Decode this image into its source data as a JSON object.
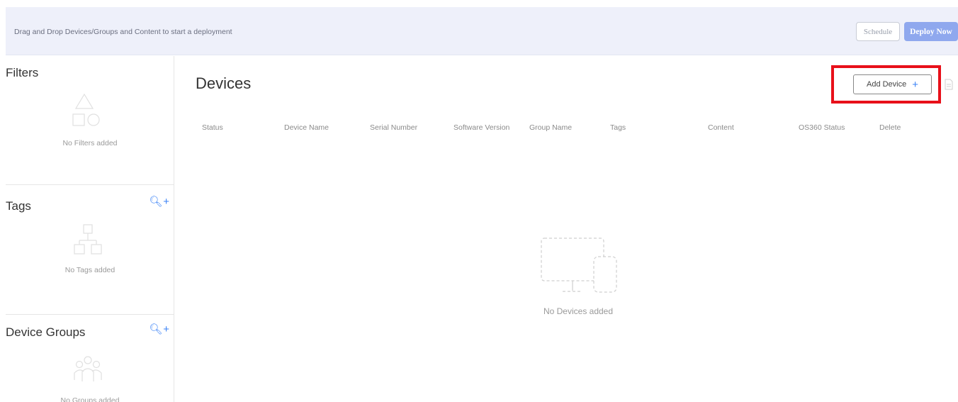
{
  "topbar": {
    "hint": "Drag and Drop Devices/Groups and Content to start a deployment",
    "schedule_label": "Schedule",
    "deploy_label": "Deploy Now"
  },
  "sidebar": {
    "filters": {
      "title": "Filters",
      "empty_text": "No Filters added",
      "icon": "shapes-icon"
    },
    "tags": {
      "title": "Tags",
      "empty_text": "No Tags added",
      "icon": "hierarchy-icon"
    },
    "groups": {
      "title": "Device Groups",
      "empty_text": "No Groups added",
      "icon": "people-group-icon"
    }
  },
  "main": {
    "title": "Devices",
    "add_device_label": "Add Device",
    "columns": [
      "Status",
      "Device Name",
      "Serial Number",
      "Software Version",
      "Group Name",
      "Tags",
      "Content",
      "OS360 Status",
      "Delete"
    ],
    "empty_text": "No Devices added"
  },
  "colors": {
    "accent": "#3b82f6",
    "deploy_button": "#8fa8ee",
    "topbar_bg": "#eef0fa",
    "highlight": "#e8101a"
  }
}
